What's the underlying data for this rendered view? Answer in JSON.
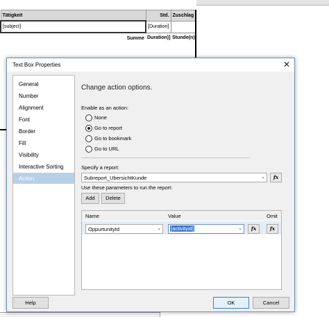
{
  "report": {
    "headers": [
      "Tätigkeit",
      "Std.",
      "Zuschlag"
    ],
    "row1": {
      "subject": "[subject]",
      "duration": "[Duration]"
    },
    "sum_row": {
      "label": "Summe",
      "duration": "Duration)]",
      "hours": "Stunde(n)"
    }
  },
  "dialog": {
    "title": "Text Box Properties",
    "close_glyph": "✕",
    "nav_items": [
      "General",
      "Number",
      "Alignment",
      "Font",
      "Border",
      "Fill",
      "Visibility",
      "Interactive Sorting",
      "Action"
    ],
    "heading": "Change action options.",
    "enable_label": "Enable as an action:",
    "radio_options": [
      "None",
      "Go to report",
      "Go to bookmark",
      "Go to URL"
    ],
    "selected_option": "Go to report",
    "specify_label": "Specify a report:",
    "report_value": "Subreport_UbersichtKunde",
    "fx_label": "fx",
    "params_label": "Use these parameters to run the report:",
    "add_button": "Add",
    "delete_button": "Delete",
    "grid_headers": {
      "name": "Name",
      "value": "Value",
      "omit": "Omit"
    },
    "param_row": {
      "name": "OppurtunityId",
      "value": "[activityid]"
    },
    "help_button": "Help",
    "ok_button": "OK",
    "cancel_button": "Cancel"
  }
}
